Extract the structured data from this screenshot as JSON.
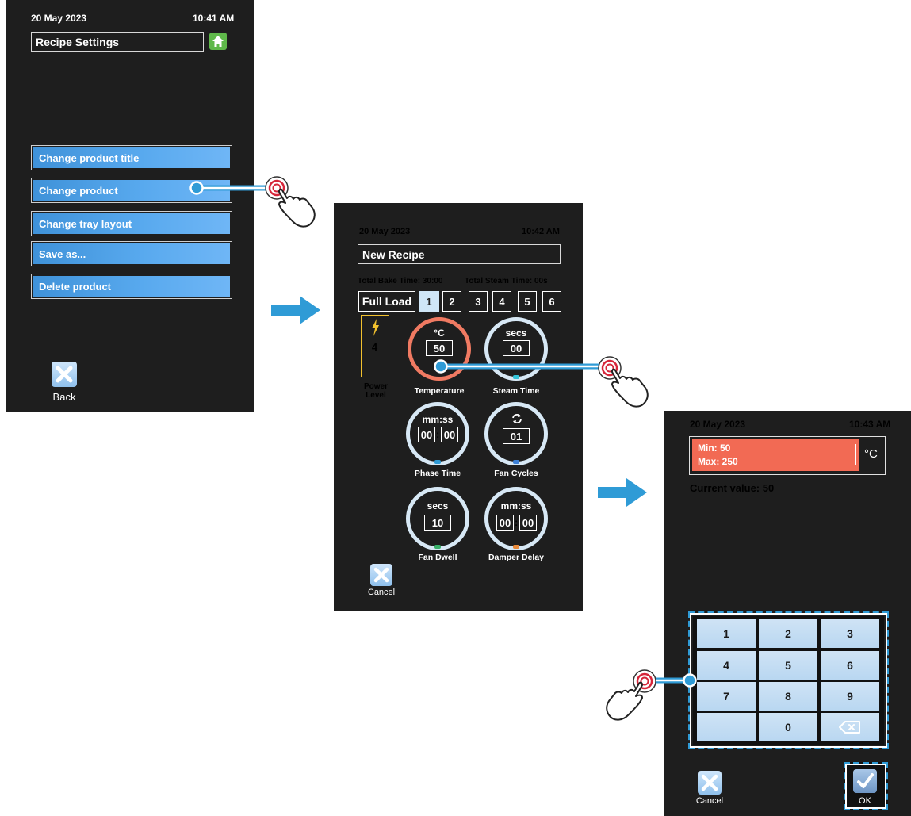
{
  "screen1": {
    "date": "20 May 2023",
    "time": "10:41 AM",
    "title": "Recipe Settings",
    "menu": [
      {
        "label": "Change product title"
      },
      {
        "label": "Change product"
      },
      {
        "label": "Change tray layout"
      },
      {
        "label": "Save as..."
      },
      {
        "label": "Delete product"
      }
    ],
    "back_label": "Back"
  },
  "screen2": {
    "date": "20 May 2023",
    "time": "10:42 AM",
    "title": "New Recipe",
    "total_bake": "Total Bake Time: 30:00",
    "total_steam": "Total Steam Time: 00s",
    "full_load": "Full Load",
    "tabs": [
      "1",
      "2",
      "3",
      "4",
      "5",
      "6"
    ],
    "active_tab": "1",
    "power_value": "4",
    "power_label": "Power Level",
    "temperature": {
      "unit": "°C",
      "value": "50",
      "label": "Temperature"
    },
    "steam_time": {
      "unit": "secs",
      "value": "00",
      "label": "Steam Time"
    },
    "phase_time": {
      "unit": "mm:ss",
      "mm": "00",
      "ss": "00",
      "label": "Phase Time"
    },
    "fan_cycles": {
      "value": "01",
      "label": "Fan Cycles"
    },
    "fan_dwell": {
      "unit": "secs",
      "value": "10",
      "label": "Fan Dwell"
    },
    "damper_delay": {
      "unit": "mm:ss",
      "mm": "00",
      "ss": "00",
      "label": "Damper Delay"
    },
    "cancel_label": "Cancel"
  },
  "screen3": {
    "date": "20 May 2023",
    "time": "10:43 AM",
    "min": "Min: 50",
    "max": "Max: 250",
    "unit": "°C",
    "current_value": "Current value: 50",
    "keys": [
      "1",
      "2",
      "3",
      "4",
      "5",
      "6",
      "7",
      "8",
      "9",
      "",
      "0"
    ],
    "cancel_label": "Cancel",
    "ok_label": "OK"
  },
  "colors": {
    "screen_bg": "#1e1e1e",
    "button_blue": "#58a9ee",
    "accent_blue": "#2f9bd6",
    "temp_red": "#f07a62",
    "power_yellow": "#f2c12e",
    "home_green": "#5fb84a"
  }
}
